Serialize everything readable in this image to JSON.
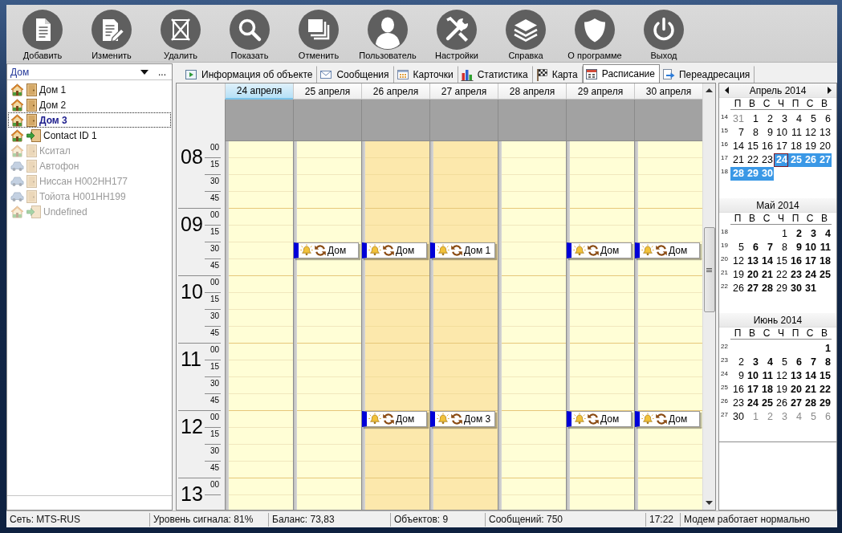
{
  "toolbar": [
    {
      "kind": "add",
      "label": "Добавить"
    },
    {
      "kind": "edit",
      "label": "Изменить"
    },
    {
      "kind": "delete",
      "label": "Удалить"
    },
    {
      "kind": "show",
      "label": "Показать"
    },
    {
      "kind": "cancel",
      "label": "Отменить"
    },
    {
      "kind": "user",
      "label": "Пользователь"
    },
    {
      "kind": "settings",
      "label": "Настройки"
    },
    {
      "kind": "help",
      "label": "Справка"
    },
    {
      "kind": "about",
      "label": "О программе"
    },
    {
      "kind": "exit",
      "label": "Выход"
    }
  ],
  "sidebar": {
    "selector": {
      "value": "Дом",
      "more_button": "..."
    },
    "items": [
      {
        "label": "Дом 1",
        "kind": "door",
        "selected": false,
        "disabled": false
      },
      {
        "label": "Дом 2",
        "kind": "door",
        "selected": false,
        "disabled": false
      },
      {
        "label": "Дом 3",
        "kind": "door",
        "selected": true,
        "disabled": false
      },
      {
        "label": "Contact ID 1",
        "kind": "contact",
        "selected": false,
        "disabled": false
      },
      {
        "label": "Кситал",
        "kind": "door",
        "selected": false,
        "disabled": true
      },
      {
        "label": "Автофон",
        "kind": "car",
        "selected": false,
        "disabled": true
      },
      {
        "label": "Ниссан Н002НН177",
        "kind": "car",
        "selected": false,
        "disabled": true
      },
      {
        "label": "Тойота Н001НН199",
        "kind": "car",
        "selected": false,
        "disabled": true
      },
      {
        "label": "Undefined",
        "kind": "contact",
        "selected": false,
        "disabled": true
      }
    ]
  },
  "tabs": [
    {
      "kind": "info",
      "label": "Информация об объекте",
      "selected": false
    },
    {
      "kind": "messages",
      "label": "Сообщения",
      "selected": false
    },
    {
      "kind": "cards",
      "label": "Карточки",
      "selected": false
    },
    {
      "kind": "stats",
      "label": "Статистика",
      "selected": false
    },
    {
      "kind": "map",
      "label": "Карта",
      "selected": false
    },
    {
      "kind": "schedule",
      "label": "Расписание",
      "selected": true
    },
    {
      "kind": "forward",
      "label": "Переадресация",
      "selected": false
    }
  ],
  "schedule": {
    "hours": [
      {
        "hour": "08",
        "minutes": [
          "00",
          "15",
          "30",
          "45"
        ]
      },
      {
        "hour": "09",
        "minutes": [
          "00",
          "15",
          "30",
          "45"
        ]
      },
      {
        "hour": "10",
        "minutes": [
          "00",
          "15",
          "30",
          "45"
        ]
      },
      {
        "hour": "11",
        "minutes": [
          "00",
          "15",
          "30",
          "45"
        ]
      },
      {
        "hour": "12",
        "minutes": [
          "00",
          "15",
          "30",
          "45"
        ]
      },
      {
        "hour": "13",
        "minutes": [
          "00"
        ]
      }
    ],
    "days": [
      {
        "date": "24 апреля",
        "selected": true,
        "weekend": false,
        "slots": [
          {
            "booked": false
          },
          {
            "booked": false
          },
          {
            "booked": false
          },
          {
            "booked": false
          },
          {
            "booked": false
          },
          {
            "booked": false
          },
          {
            "booked": false
          },
          {
            "booked": false
          },
          {
            "booked": false
          },
          {
            "booked": false
          },
          {
            "booked": false
          },
          {
            "booked": false
          },
          {
            "booked": false
          },
          {
            "booked": false
          },
          {
            "booked": false
          },
          {
            "booked": false
          },
          {
            "booked": false
          },
          {
            "booked": false
          },
          {
            "booked": false
          },
          {
            "booked": false
          },
          {
            "booked": false
          }
        ]
      },
      {
        "date": "25 апреля",
        "selected": false,
        "weekend": false,
        "slots": [
          {
            "booked": false
          },
          {
            "booked": false
          },
          {
            "booked": false
          },
          {
            "booked": false
          },
          {
            "booked": false
          },
          {
            "booked": false
          },
          {
            "booked": true,
            "label": "Дом",
            "alarm": true,
            "recurring": true
          },
          {
            "booked": false
          },
          {
            "booked": false
          },
          {
            "booked": false
          },
          {
            "booked": false
          },
          {
            "booked": false
          },
          {
            "booked": false
          },
          {
            "booked": false
          },
          {
            "booked": false
          },
          {
            "booked": false
          },
          {
            "booked": false
          },
          {
            "booked": false
          },
          {
            "booked": false
          },
          {
            "booked": false
          },
          {
            "booked": false
          }
        ]
      },
      {
        "date": "26 апреля",
        "selected": false,
        "weekend": true,
        "slots": [
          {
            "booked": false
          },
          {
            "booked": false
          },
          {
            "booked": false
          },
          {
            "booked": false
          },
          {
            "booked": false
          },
          {
            "booked": false
          },
          {
            "booked": true,
            "label": "Дом",
            "alarm": true,
            "recurring": true
          },
          {
            "booked": false
          },
          {
            "booked": false
          },
          {
            "booked": false
          },
          {
            "booked": false
          },
          {
            "booked": false
          },
          {
            "booked": false
          },
          {
            "booked": false
          },
          {
            "booked": false
          },
          {
            "booked": false
          },
          {
            "booked": true,
            "label": "Дом",
            "alarm": true,
            "recurring": true
          },
          {
            "booked": false
          },
          {
            "booked": false
          },
          {
            "booked": false
          },
          {
            "booked": false
          }
        ]
      },
      {
        "date": "27 апреля",
        "selected": false,
        "weekend": true,
        "slots": [
          {
            "booked": false
          },
          {
            "booked": false
          },
          {
            "booked": false
          },
          {
            "booked": false
          },
          {
            "booked": false
          },
          {
            "booked": false
          },
          {
            "booked": true,
            "label": "Дом 1",
            "alarm": true,
            "recurring": true
          },
          {
            "booked": false
          },
          {
            "booked": false
          },
          {
            "booked": false
          },
          {
            "booked": false
          },
          {
            "booked": false
          },
          {
            "booked": false
          },
          {
            "booked": false
          },
          {
            "booked": false
          },
          {
            "booked": false
          },
          {
            "booked": true,
            "label": "Дом 3",
            "alarm": true,
            "recurring": true
          },
          {
            "booked": false
          },
          {
            "booked": false
          },
          {
            "booked": false
          },
          {
            "booked": false
          }
        ]
      },
      {
        "date": "28 апреля",
        "selected": false,
        "weekend": false,
        "slots": [
          {
            "booked": false
          },
          {
            "booked": false
          },
          {
            "booked": false
          },
          {
            "booked": false
          },
          {
            "booked": false
          },
          {
            "booked": false
          },
          {
            "booked": false
          },
          {
            "booked": false
          },
          {
            "booked": false
          },
          {
            "booked": false
          },
          {
            "booked": false
          },
          {
            "booked": false
          },
          {
            "booked": false
          },
          {
            "booked": false
          },
          {
            "booked": false
          },
          {
            "booked": false
          },
          {
            "booked": false
          },
          {
            "booked": false
          },
          {
            "booked": false
          },
          {
            "booked": false
          },
          {
            "booked": false
          }
        ]
      },
      {
        "date": "29 апреля",
        "selected": false,
        "weekend": false,
        "slots": [
          {
            "booked": false
          },
          {
            "booked": false
          },
          {
            "booked": false
          },
          {
            "booked": false
          },
          {
            "booked": false
          },
          {
            "booked": false
          },
          {
            "booked": true,
            "label": "Дом",
            "alarm": true,
            "recurring": true
          },
          {
            "booked": false
          },
          {
            "booked": false
          },
          {
            "booked": false
          },
          {
            "booked": false
          },
          {
            "booked": false
          },
          {
            "booked": false
          },
          {
            "booked": false
          },
          {
            "booked": false
          },
          {
            "booked": false
          },
          {
            "booked": true,
            "label": "Дом",
            "alarm": true,
            "recurring": true
          },
          {
            "booked": false
          },
          {
            "booked": false
          },
          {
            "booked": false
          },
          {
            "booked": false
          }
        ]
      },
      {
        "date": "30 апреля",
        "selected": false,
        "weekend": false,
        "slots": [
          {
            "booked": false
          },
          {
            "booked": false
          },
          {
            "booked": false
          },
          {
            "booked": false
          },
          {
            "booked": false
          },
          {
            "booked": false
          },
          {
            "booked": true,
            "label": "Дом",
            "alarm": true,
            "recurring": true
          },
          {
            "booked": false
          },
          {
            "booked": false
          },
          {
            "booked": false
          },
          {
            "booked": false
          },
          {
            "booked": false
          },
          {
            "booked": false
          },
          {
            "booked": false
          },
          {
            "booked": false
          },
          {
            "booked": false
          },
          {
            "booked": true,
            "label": "Дом",
            "alarm": true,
            "recurring": true
          },
          {
            "booked": false
          },
          {
            "booked": false
          },
          {
            "booked": false
          },
          {
            "booked": false
          }
        ]
      }
    ]
  },
  "mini_calendars": [
    {
      "title": "Апрель 2014",
      "nav_arrows": true,
      "weekdays": [
        "П",
        "В",
        "С",
        "Ч",
        "П",
        "С",
        "В"
      ],
      "weeks": [
        {
          "number": "14",
          "days": [
            {
              "day": "31",
              "muted": true,
              "has_events": false,
              "selected": false,
              "today": false
            },
            {
              "day": "1",
              "muted": false,
              "has_events": false,
              "selected": false,
              "today": false
            },
            {
              "day": "2",
              "muted": false,
              "has_events": false,
              "selected": false,
              "today": false
            },
            {
              "day": "3",
              "muted": false,
              "has_events": false,
              "selected": false,
              "today": false
            },
            {
              "day": "4",
              "muted": false,
              "has_events": false,
              "selected": false,
              "today": false
            },
            {
              "day": "5",
              "muted": false,
              "has_events": false,
              "selected": false,
              "today": false
            },
            {
              "day": "6",
              "muted": false,
              "has_events": false,
              "selected": false,
              "today": false
            }
          ]
        },
        {
          "number": "15",
          "days": [
            {
              "day": "7",
              "muted": false,
              "has_events": false,
              "selected": false,
              "today": false
            },
            {
              "day": "8",
              "muted": false,
              "has_events": false,
              "selected": false,
              "today": false
            },
            {
              "day": "9",
              "muted": false,
              "has_events": false,
              "selected": false,
              "today": false
            },
            {
              "day": "10",
              "muted": false,
              "has_events": false,
              "selected": false,
              "today": false
            },
            {
              "day": "11",
              "muted": false,
              "has_events": false,
              "selected": false,
              "today": false
            },
            {
              "day": "12",
              "muted": false,
              "has_events": false,
              "selected": false,
              "today": false
            },
            {
              "day": "13",
              "muted": false,
              "has_events": false,
              "selected": false,
              "today": false
            }
          ]
        },
        {
          "number": "16",
          "days": [
            {
              "day": "14",
              "muted": false,
              "has_events": false,
              "selected": false,
              "today": false
            },
            {
              "day": "15",
              "muted": false,
              "has_events": false,
              "selected": false,
              "today": false
            },
            {
              "day": "16",
              "muted": false,
              "has_events": false,
              "selected": false,
              "today": false
            },
            {
              "day": "17",
              "muted": false,
              "has_events": false,
              "selected": false,
              "today": false
            },
            {
              "day": "18",
              "muted": false,
              "has_events": false,
              "selected": false,
              "today": false
            },
            {
              "day": "19",
              "muted": false,
              "has_events": false,
              "selected": false,
              "today": false
            },
            {
              "day": "20",
              "muted": false,
              "has_events": false,
              "selected": false,
              "today": false
            }
          ]
        },
        {
          "number": "17",
          "days": [
            {
              "day": "21",
              "muted": false,
              "has_events": false,
              "selected": false,
              "today": false
            },
            {
              "day": "22",
              "muted": false,
              "has_events": false,
              "selected": false,
              "today": false
            },
            {
              "day": "23",
              "muted": false,
              "has_events": false,
              "selected": false,
              "today": false
            },
            {
              "day": "24",
              "muted": false,
              "has_events": true,
              "selected": true,
              "today": true
            },
            {
              "day": "25",
              "muted": false,
              "has_events": true,
              "selected": true,
              "today": false
            },
            {
              "day": "26",
              "muted": false,
              "has_events": true,
              "selected": true,
              "today": false
            },
            {
              "day": "27",
              "muted": false,
              "has_events": true,
              "selected": true,
              "today": false
            }
          ]
        },
        {
          "number": "18",
          "days": [
            {
              "day": "28",
              "muted": false,
              "has_events": true,
              "selected": true,
              "today": false
            },
            {
              "day": "29",
              "muted": false,
              "has_events": true,
              "selected": true,
              "today": false
            },
            {
              "day": "30",
              "muted": false,
              "has_events": true,
              "selected": true,
              "today": false
            }
          ]
        }
      ]
    },
    {
      "title": "Май 2014",
      "nav_arrows": false,
      "weekdays": [
        "П",
        "В",
        "С",
        "Ч",
        "П",
        "С",
        "В"
      ],
      "weeks": [
        {
          "number": "18",
          "days": [
            {
              "day": "1",
              "muted": false,
              "has_events": false,
              "selected": false,
              "today": false
            },
            {
              "day": "2",
              "muted": false,
              "has_events": true,
              "selected": false,
              "today": false
            },
            {
              "day": "3",
              "muted": false,
              "has_events": true,
              "selected": false,
              "today": false
            },
            {
              "day": "4",
              "muted": false,
              "has_events": true,
              "selected": false,
              "today": false
            }
          ]
        },
        {
          "number": "19",
          "days": [
            {
              "day": "5",
              "muted": false,
              "has_events": false,
              "selected": false,
              "today": false
            },
            {
              "day": "6",
              "muted": false,
              "has_events": true,
              "selected": false,
              "today": false
            },
            {
              "day": "7",
              "muted": false,
              "has_events": true,
              "selected": false,
              "today": false
            },
            {
              "day": "8",
              "muted": false,
              "has_events": false,
              "selected": false,
              "today": false
            },
            {
              "day": "9",
              "muted": false,
              "has_events": true,
              "selected": false,
              "today": false
            },
            {
              "day": "10",
              "muted": false,
              "has_events": true,
              "selected": false,
              "today": false
            },
            {
              "day": "11",
              "muted": false,
              "has_events": true,
              "selected": false,
              "today": false
            }
          ]
        },
        {
          "number": "20",
          "days": [
            {
              "day": "12",
              "muted": false,
              "has_events": false,
              "selected": false,
              "today": false
            },
            {
              "day": "13",
              "muted": false,
              "has_events": true,
              "selected": false,
              "today": false
            },
            {
              "day": "14",
              "muted": false,
              "has_events": true,
              "selected": false,
              "today": false
            },
            {
              "day": "15",
              "muted": false,
              "has_events": false,
              "selected": false,
              "today": false
            },
            {
              "day": "16",
              "muted": false,
              "has_events": true,
              "selected": false,
              "today": false
            },
            {
              "day": "17",
              "muted": false,
              "has_events": true,
              "selected": false,
              "today": false
            },
            {
              "day": "18",
              "muted": false,
              "has_events": true,
              "selected": false,
              "today": false
            }
          ]
        },
        {
          "number": "21",
          "days": [
            {
              "day": "19",
              "muted": false,
              "has_events": false,
              "selected": false,
              "today": false
            },
            {
              "day": "20",
              "muted": false,
              "has_events": true,
              "selected": false,
              "today": false
            },
            {
              "day": "21",
              "muted": false,
              "has_events": true,
              "selected": false,
              "today": false
            },
            {
              "day": "22",
              "muted": false,
              "has_events": false,
              "selected": false,
              "today": false
            },
            {
              "day": "23",
              "muted": false,
              "has_events": true,
              "selected": false,
              "today": false
            },
            {
              "day": "24",
              "muted": false,
              "has_events": true,
              "selected": false,
              "today": false
            },
            {
              "day": "25",
              "muted": false,
              "has_events": true,
              "selected": false,
              "today": false
            }
          ]
        },
        {
          "number": "22",
          "days": [
            {
              "day": "26",
              "muted": false,
              "has_events": false,
              "selected": false,
              "today": false
            },
            {
              "day": "27",
              "muted": false,
              "has_events": true,
              "selected": false,
              "today": false
            },
            {
              "day": "28",
              "muted": false,
              "has_events": true,
              "selected": false,
              "today": false
            },
            {
              "day": "29",
              "muted": false,
              "has_events": false,
              "selected": false,
              "today": false
            },
            {
              "day": "30",
              "muted": false,
              "has_events": true,
              "selected": false,
              "today": false
            },
            {
              "day": "31",
              "muted": false,
              "has_events": true,
              "selected": false,
              "today": false
            }
          ]
        }
      ]
    },
    {
      "title": "Июнь 2014",
      "nav_arrows": false,
      "weekdays": [
        "П",
        "В",
        "С",
        "Ч",
        "П",
        "С",
        "В"
      ],
      "weeks": [
        {
          "number": "22",
          "days": [
            {
              "day": "1",
              "muted": false,
              "has_events": true,
              "selected": false,
              "today": false
            }
          ]
        },
        {
          "number": "23",
          "days": [
            {
              "day": "2",
              "muted": false,
              "has_events": false,
              "selected": false,
              "today": false
            },
            {
              "day": "3",
              "muted": false,
              "has_events": true,
              "selected": false,
              "today": false
            },
            {
              "day": "4",
              "muted": false,
              "has_events": true,
              "selected": false,
              "today": false
            },
            {
              "day": "5",
              "muted": false,
              "has_events": false,
              "selected": false,
              "today": false
            },
            {
              "day": "6",
              "muted": false,
              "has_events": true,
              "selected": false,
              "today": false
            },
            {
              "day": "7",
              "muted": false,
              "has_events": true,
              "selected": false,
              "today": false
            },
            {
              "day": "8",
              "muted": false,
              "has_events": true,
              "selected": false,
              "today": false
            }
          ]
        },
        {
          "number": "24",
          "days": [
            {
              "day": "9",
              "muted": false,
              "has_events": false,
              "selected": false,
              "today": false
            },
            {
              "day": "10",
              "muted": false,
              "has_events": true,
              "selected": false,
              "today": false
            },
            {
              "day": "11",
              "muted": false,
              "has_events": true,
              "selected": false,
              "today": false
            },
            {
              "day": "12",
              "muted": false,
              "has_events": false,
              "selected": false,
              "today": false
            },
            {
              "day": "13",
              "muted": false,
              "has_events": true,
              "selected": false,
              "today": false
            },
            {
              "day": "14",
              "muted": false,
              "has_events": true,
              "selected": false,
              "today": false
            },
            {
              "day": "15",
              "muted": false,
              "has_events": true,
              "selected": false,
              "today": false
            }
          ]
        },
        {
          "number": "25",
          "days": [
            {
              "day": "16",
              "muted": false,
              "has_events": false,
              "selected": false,
              "today": false
            },
            {
              "day": "17",
              "muted": false,
              "has_events": true,
              "selected": false,
              "today": false
            },
            {
              "day": "18",
              "muted": false,
              "has_events": true,
              "selected": false,
              "today": false
            },
            {
              "day": "19",
              "muted": false,
              "has_events": false,
              "selected": false,
              "today": false
            },
            {
              "day": "20",
              "muted": false,
              "has_events": true,
              "selected": false,
              "today": false
            },
            {
              "day": "21",
              "muted": false,
              "has_events": true,
              "selected": false,
              "today": false
            },
            {
              "day": "22",
              "muted": false,
              "has_events": true,
              "selected": false,
              "today": false
            }
          ]
        },
        {
          "number": "26",
          "days": [
            {
              "day": "23",
              "muted": false,
              "has_events": false,
              "selected": false,
              "today": false
            },
            {
              "day": "24",
              "muted": false,
              "has_events": true,
              "selected": false,
              "today": false
            },
            {
              "day": "25",
              "muted": false,
              "has_events": true,
              "selected": false,
              "today": false
            },
            {
              "day": "26",
              "muted": false,
              "has_events": false,
              "selected": false,
              "today": false
            },
            {
              "day": "27",
              "muted": false,
              "has_events": true,
              "selected": false,
              "today": false
            },
            {
              "day": "28",
              "muted": false,
              "has_events": true,
              "selected": false,
              "today": false
            },
            {
              "day": "29",
              "muted": false,
              "has_events": true,
              "selected": false,
              "today": false
            }
          ]
        },
        {
          "number": "27",
          "days": [
            {
              "day": "30",
              "muted": false,
              "has_events": false,
              "selected": false,
              "today": false
            },
            {
              "day": "1",
              "muted": true,
              "has_events": false,
              "selected": false,
              "today": false
            },
            {
              "day": "2",
              "muted": true,
              "has_events": false,
              "selected": false,
              "today": false
            },
            {
              "day": "3",
              "muted": true,
              "has_events": false,
              "selected": false,
              "today": false
            },
            {
              "day": "4",
              "muted": true,
              "has_events": false,
              "selected": false,
              "today": false
            },
            {
              "day": "5",
              "muted": true,
              "has_events": false,
              "selected": false,
              "today": false
            },
            {
              "day": "6",
              "muted": true,
              "has_events": false,
              "selected": false,
              "today": false
            }
          ]
        }
      ]
    }
  ],
  "status_bar": [
    "Сеть: MTS-RUS",
    "Уровень сигнала: 81%",
    "Баланс: 73,83",
    "Объектов: 9",
    "Сообщений: 750",
    "17:22",
    "Модем работает нормально"
  ]
}
